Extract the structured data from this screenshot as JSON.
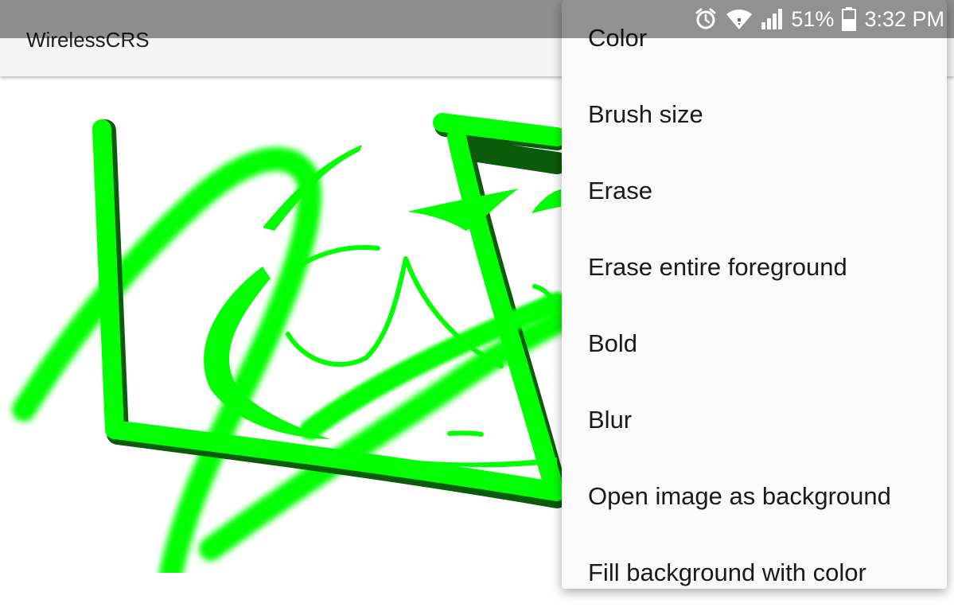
{
  "status_bar": {
    "battery_percent": "51%",
    "time": "3:32 PM",
    "icons": [
      "alarm-icon",
      "wifi-icon",
      "cell-signal-icon",
      "battery-icon"
    ]
  },
  "app_bar": {
    "title": "WirelessCRS"
  },
  "menu": {
    "items": [
      {
        "label": "Color"
      },
      {
        "label": "Brush size"
      },
      {
        "label": "Erase"
      },
      {
        "label": "Erase entire foreground"
      },
      {
        "label": "Bold"
      },
      {
        "label": "Blur"
      },
      {
        "label": "Open image as background"
      },
      {
        "label": "Fill background with color"
      }
    ]
  },
  "colors": {
    "brush": "#00ff00",
    "brush_shadow": "#0a5c0a",
    "status_bar": "#6b6b6b",
    "menu_bg": "#fafafa",
    "app_bar_bg": "#f5f5f5"
  }
}
